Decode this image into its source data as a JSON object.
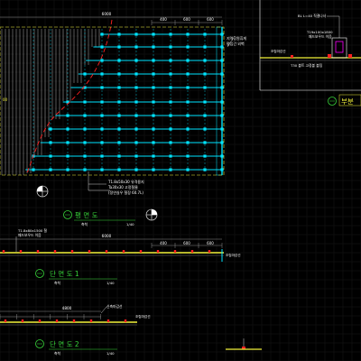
{
  "colors": {
    "background": "#000000",
    "white": "#ffffff",
    "cyan": "#00e5ff",
    "green": "#38d63a",
    "yellow": "#f2f23a",
    "red": "#ff2020",
    "magenta": "#ff00ff",
    "grey": "#8c8c8c",
    "grid": "#1c1c1c"
  },
  "plan": {
    "overall_dim": "6000",
    "top_dims": [
      "400",
      "600",
      "600"
    ],
    "right_note_1": "지역공원휴게",
    "right_note_2": "평입간 외벽",
    "left_note": "00",
    "callout_1": "T1.8x50x30 유격용지",
    "callout_2": "Ta30x30 고정철물",
    "callout_3": "(정연실우 철장 60.7L)",
    "title": "평 면 도",
    "scale_left": "축척",
    "scale": "1/40"
  },
  "section_1": {
    "overall_dim": "6000",
    "dims": [
      "400",
      "600",
      "600"
    ],
    "note_1": "T1.8x80x1500 철",
    "note_2": "패드보우드 이음",
    "edge_note": "조립마감선",
    "title": "단 면 도 1",
    "scale_left": "축척",
    "scale": "1/40"
  },
  "section_2": {
    "overall_dim": "4800",
    "right_label": "신축마감선",
    "edge_note": "조립마감선",
    "title": "단 면 도 2",
    "scale_left": "축척",
    "scale": "1/40"
  },
  "detail": {
    "label_1": "BL L=40 직결나사",
    "label_2": "T19x100x1800",
    "label_3": "패드보우드 이음",
    "label_4": "조립마감선",
    "label_5": "T30 볼트 고정볼 볼팅",
    "title": "부분"
  }
}
